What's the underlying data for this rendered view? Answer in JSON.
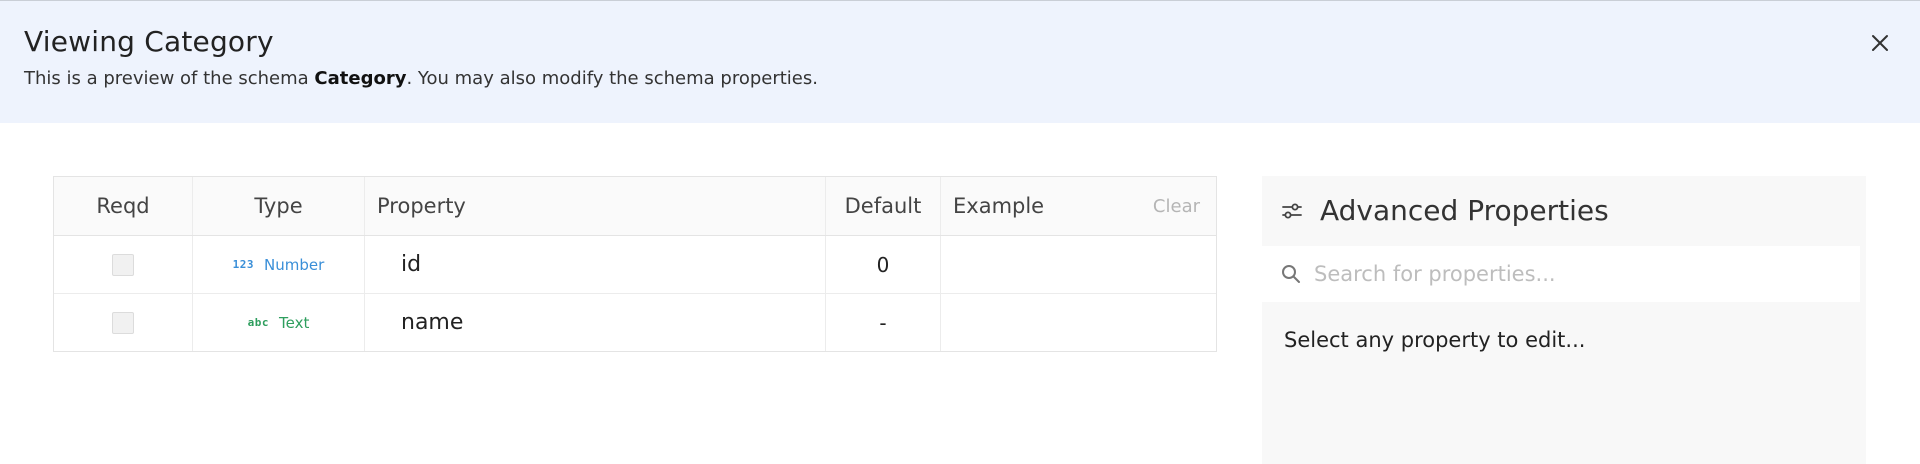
{
  "header": {
    "title": "Viewing Category",
    "subtitle_before": "This is a preview of the schema ",
    "subtitle_schema": "Category",
    "subtitle_after": ". You may also modify the schema properties.",
    "close_icon": "close-icon"
  },
  "table": {
    "columns": {
      "reqd": "Reqd",
      "type": "Type",
      "property": "Property",
      "default": "Default",
      "example": "Example",
      "clear": "Clear"
    },
    "rows": [
      {
        "reqd": false,
        "type_icon": "123",
        "type_label": "Number",
        "type_color": "#3a8fd8",
        "property": "id",
        "default": "0",
        "example": ""
      },
      {
        "reqd": false,
        "type_icon": "abc",
        "type_label": "Text",
        "type_color": "#2e9e5e",
        "property": "name",
        "default": "-",
        "example": ""
      }
    ]
  },
  "advanced": {
    "title": "Advanced Properties",
    "title_icon": "sliders-icon",
    "search_placeholder": "Search for properties...",
    "search_icon": "search-icon",
    "hint": "Select any property to edit..."
  }
}
